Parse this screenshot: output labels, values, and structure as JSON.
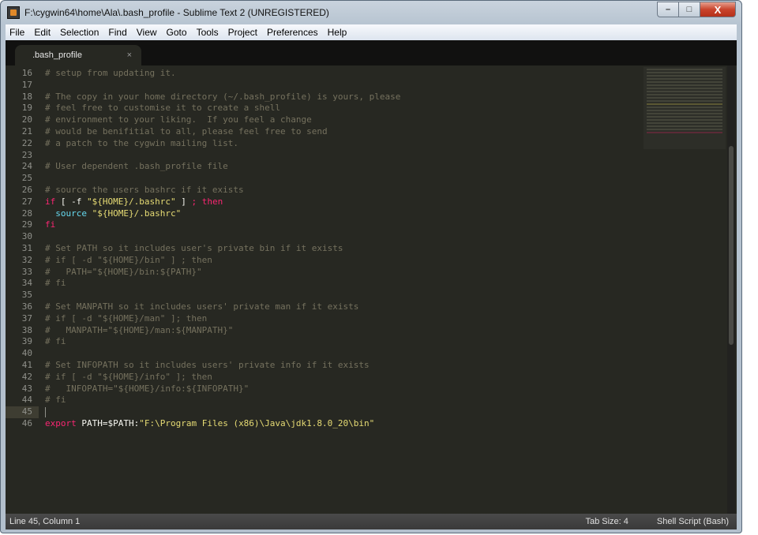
{
  "window": {
    "title": "F:\\cygwin64\\home\\Ala\\.bash_profile - Sublime Text 2 (UNREGISTERED)",
    "app_icon": "sublime-text-icon",
    "controls": {
      "minimize": "–",
      "maximize": "□",
      "close": "X"
    }
  },
  "menu": [
    {
      "label": "File"
    },
    {
      "label": "Edit"
    },
    {
      "label": "Selection"
    },
    {
      "label": "Find"
    },
    {
      "label": "View"
    },
    {
      "label": "Goto"
    },
    {
      "label": "Tools"
    },
    {
      "label": "Project"
    },
    {
      "label": "Preferences"
    },
    {
      "label": "Help"
    }
  ],
  "tabs": [
    {
      "label": ".bash_profile",
      "close": "×",
      "active": true
    }
  ],
  "editor": {
    "current_line": 45,
    "lines": [
      {
        "n": "16",
        "tokens": [
          {
            "t": "# setup from updating it.",
            "c": "comment"
          }
        ]
      },
      {
        "n": "17",
        "tokens": []
      },
      {
        "n": "18",
        "tokens": [
          {
            "t": "# The copy in your home directory (~/.bash_profile) is yours, please",
            "c": "comment"
          }
        ]
      },
      {
        "n": "19",
        "tokens": [
          {
            "t": "# feel free to customise it to create a shell",
            "c": "comment"
          }
        ]
      },
      {
        "n": "20",
        "tokens": [
          {
            "t": "# environment to your liking.  If you feel a change",
            "c": "comment"
          }
        ]
      },
      {
        "n": "21",
        "tokens": [
          {
            "t": "# would be benifitial to all, please feel free to send",
            "c": "comment"
          }
        ]
      },
      {
        "n": "22",
        "tokens": [
          {
            "t": "# a patch to the cygwin mailing list.",
            "c": "comment"
          }
        ]
      },
      {
        "n": "23",
        "tokens": []
      },
      {
        "n": "24",
        "tokens": [
          {
            "t": "# User dependent .bash_profile file",
            "c": "comment"
          }
        ]
      },
      {
        "n": "25",
        "tokens": []
      },
      {
        "n": "26",
        "tokens": [
          {
            "t": "# source the users bashrc if it exists",
            "c": "comment"
          }
        ]
      },
      {
        "n": "27",
        "tokens": [
          {
            "t": "if",
            "c": "kw"
          },
          {
            "t": " [ -f ",
            "c": "plain"
          },
          {
            "t": "\"${HOME}/.bashrc\"",
            "c": "str"
          },
          {
            "t": " ] ",
            "c": "plain"
          },
          {
            "t": "; then",
            "c": "kw"
          }
        ]
      },
      {
        "n": "28",
        "tokens": [
          {
            "t": "  ",
            "c": "plain"
          },
          {
            "t": "source",
            "c": "fn"
          },
          {
            "t": " ",
            "c": "plain"
          },
          {
            "t": "\"${HOME}/.bashrc\"",
            "c": "str"
          }
        ]
      },
      {
        "n": "29",
        "tokens": [
          {
            "t": "fi",
            "c": "kw"
          }
        ]
      },
      {
        "n": "30",
        "tokens": []
      },
      {
        "n": "31",
        "tokens": [
          {
            "t": "# Set PATH so it includes user's private bin if it exists",
            "c": "comment"
          }
        ]
      },
      {
        "n": "32",
        "tokens": [
          {
            "t": "# if [ -d \"${HOME}/bin\" ] ; then",
            "c": "comment"
          }
        ]
      },
      {
        "n": "33",
        "tokens": [
          {
            "t": "#   PATH=\"${HOME}/bin:${PATH}\"",
            "c": "comment"
          }
        ]
      },
      {
        "n": "34",
        "tokens": [
          {
            "t": "# fi",
            "c": "comment"
          }
        ]
      },
      {
        "n": "35",
        "tokens": []
      },
      {
        "n": "36",
        "tokens": [
          {
            "t": "# Set MANPATH so it includes users' private man if it exists",
            "c": "comment"
          }
        ]
      },
      {
        "n": "37",
        "tokens": [
          {
            "t": "# if [ -d \"${HOME}/man\" ]; then",
            "c": "comment"
          }
        ]
      },
      {
        "n": "38",
        "tokens": [
          {
            "t": "#   MANPATH=\"${HOME}/man:${MANPATH}\"",
            "c": "comment"
          }
        ]
      },
      {
        "n": "39",
        "tokens": [
          {
            "t": "# fi",
            "c": "comment"
          }
        ]
      },
      {
        "n": "40",
        "tokens": []
      },
      {
        "n": "41",
        "tokens": [
          {
            "t": "# Set INFOPATH so it includes users' private info if it exists",
            "c": "comment"
          }
        ]
      },
      {
        "n": "42",
        "tokens": [
          {
            "t": "# if [ -d \"${HOME}/info\" ]; then",
            "c": "comment"
          }
        ]
      },
      {
        "n": "43",
        "tokens": [
          {
            "t": "#   INFOPATH=\"${HOME}/info:${INFOPATH}\"",
            "c": "comment"
          }
        ]
      },
      {
        "n": "44",
        "tokens": [
          {
            "t": "# fi",
            "c": "comment"
          }
        ]
      },
      {
        "n": "45",
        "tokens": []
      },
      {
        "n": "46",
        "tokens": [
          {
            "t": "export",
            "c": "kw"
          },
          {
            "t": " PATH=$PATH:",
            "c": "plain"
          },
          {
            "t": "\"F:\\Program Files (x86)\\Java\\jdk1.8.0_20\\bin\"",
            "c": "str"
          }
        ]
      }
    ]
  },
  "syntax_colors": {
    "comment": "#75715e",
    "keyword": "#f92672",
    "string": "#e6db74",
    "function": "#66d9ef",
    "plain": "#f8f8f2"
  },
  "status": {
    "position": "Line 45, Column 1",
    "tab_size": "Tab Size: 4",
    "syntax": "Shell Script (Bash)"
  }
}
